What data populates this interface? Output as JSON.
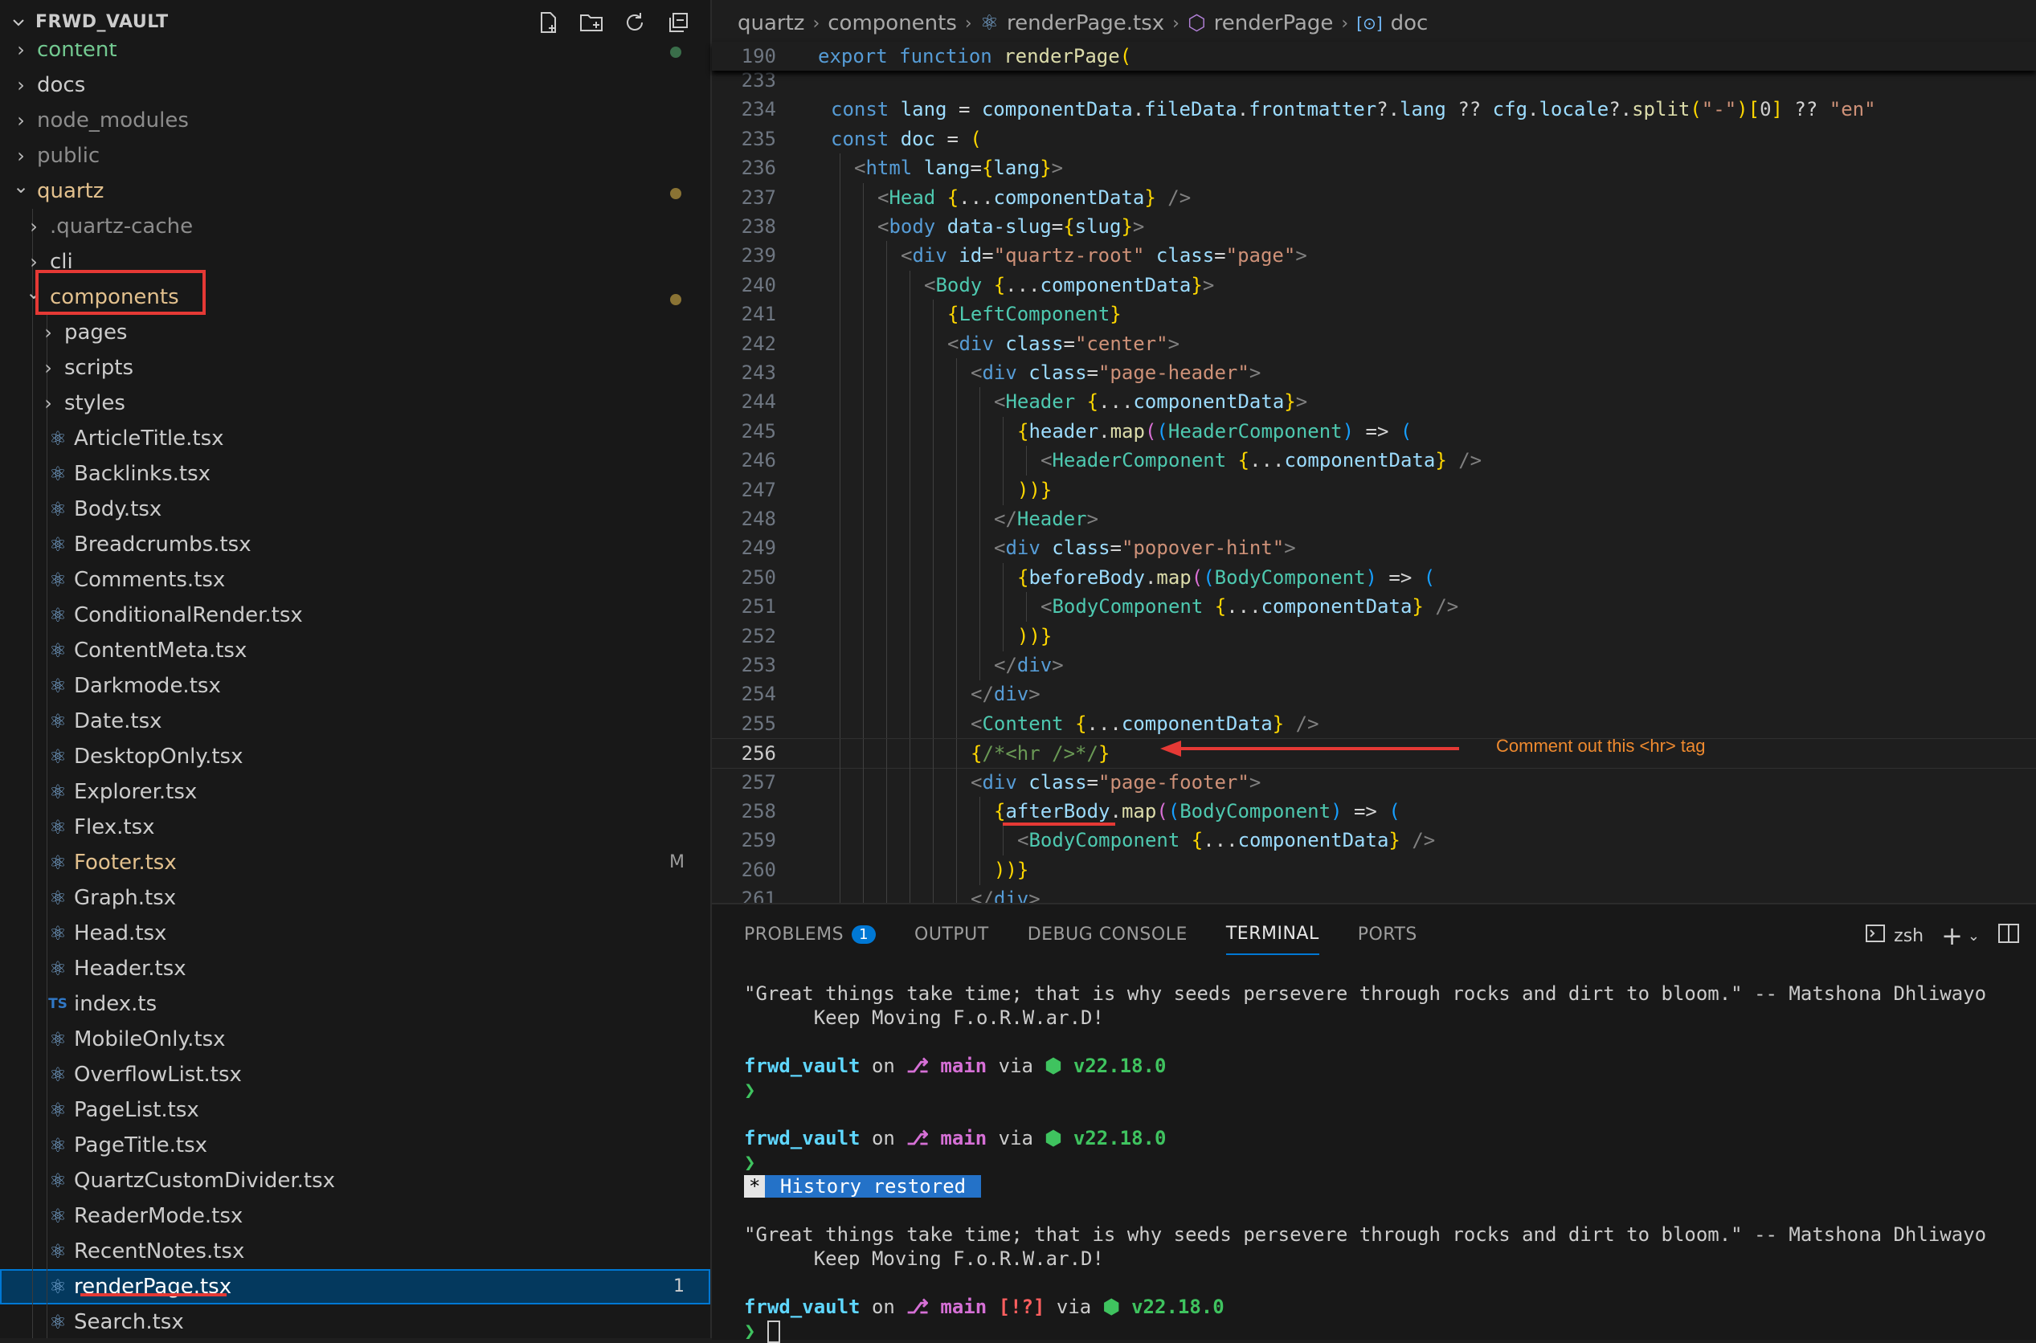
{
  "explorer": {
    "title": "FRWD_VAULT",
    "items": [
      {
        "label": "content",
        "type": "folder",
        "open": false,
        "depth": 0,
        "color": "#73c991",
        "dot": "#3a6e4a"
      },
      {
        "label": "docs",
        "type": "folder",
        "open": false,
        "depth": 0
      },
      {
        "label": "node_modules",
        "type": "folder",
        "open": false,
        "depth": 0,
        "color": "#8c8c8c"
      },
      {
        "label": "public",
        "type": "folder",
        "open": false,
        "depth": 0,
        "color": "#8c8c8c"
      },
      {
        "label": "quartz",
        "type": "folder",
        "open": true,
        "depth": 0,
        "color": "#e2c08d",
        "dot": "#8a7334"
      },
      {
        "label": ".quartz-cache",
        "type": "folder",
        "open": false,
        "depth": 1,
        "color": "#8c8c8c"
      },
      {
        "label": "cli",
        "type": "folder",
        "open": false,
        "depth": 1
      },
      {
        "label": "components",
        "type": "folder",
        "open": true,
        "depth": 1,
        "color": "#e2c08d",
        "dot": "#8a7334"
      },
      {
        "label": "pages",
        "type": "folder",
        "open": false,
        "depth": 2
      },
      {
        "label": "scripts",
        "type": "folder",
        "open": false,
        "depth": 2
      },
      {
        "label": "styles",
        "type": "folder",
        "open": false,
        "depth": 2
      },
      {
        "label": "ArticleTitle.tsx",
        "type": "react",
        "depth": 2
      },
      {
        "label": "Backlinks.tsx",
        "type": "react",
        "depth": 2
      },
      {
        "label": "Body.tsx",
        "type": "react",
        "depth": 2
      },
      {
        "label": "Breadcrumbs.tsx",
        "type": "react",
        "depth": 2
      },
      {
        "label": "Comments.tsx",
        "type": "react",
        "depth": 2
      },
      {
        "label": "ConditionalRender.tsx",
        "type": "react",
        "depth": 2
      },
      {
        "label": "ContentMeta.tsx",
        "type": "react",
        "depth": 2
      },
      {
        "label": "Darkmode.tsx",
        "type": "react",
        "depth": 2
      },
      {
        "label": "Date.tsx",
        "type": "react",
        "depth": 2
      },
      {
        "label": "DesktopOnly.tsx",
        "type": "react",
        "depth": 2
      },
      {
        "label": "Explorer.tsx",
        "type": "react",
        "depth": 2
      },
      {
        "label": "Flex.tsx",
        "type": "react",
        "depth": 2
      },
      {
        "label": "Footer.tsx",
        "type": "react",
        "depth": 2,
        "color": "#e2c08d",
        "mark": "M"
      },
      {
        "label": "Graph.tsx",
        "type": "react",
        "depth": 2
      },
      {
        "label": "Head.tsx",
        "type": "react",
        "depth": 2
      },
      {
        "label": "Header.tsx",
        "type": "react",
        "depth": 2
      },
      {
        "label": "index.ts",
        "type": "ts",
        "depth": 2
      },
      {
        "label": "MobileOnly.tsx",
        "type": "react",
        "depth": 2
      },
      {
        "label": "OverflowList.tsx",
        "type": "react",
        "depth": 2
      },
      {
        "label": "PageList.tsx",
        "type": "react",
        "depth": 2
      },
      {
        "label": "PageTitle.tsx",
        "type": "react",
        "depth": 2
      },
      {
        "label": "QuartzCustomDivider.tsx",
        "type": "react",
        "depth": 2
      },
      {
        "label": "ReaderMode.tsx",
        "type": "react",
        "depth": 2
      },
      {
        "label": "RecentNotes.tsx",
        "type": "react",
        "depth": 2
      },
      {
        "label": "renderPage.tsx",
        "type": "react",
        "depth": 2,
        "selected": true,
        "mark": "1",
        "color": "#ffffff"
      },
      {
        "label": "Search.tsx",
        "type": "react",
        "depth": 2
      }
    ],
    "ts_icon_text": "TS"
  },
  "breadcrumb": [
    "quartz",
    "components",
    "renderPage.tsx",
    "renderPage",
    "doc"
  ],
  "editor": {
    "sticky_line": {
      "num": "190",
      "code": "export function renderPage("
    },
    "lines": [
      {
        "num": "233",
        "indent": 0,
        "code": ""
      },
      {
        "num": "234",
        "indent": 1,
        "code": "const lang = componentData.fileData.frontmatter?.lang ?? cfg.locale?.split(\"-\")[0] ?? \"en\""
      },
      {
        "num": "235",
        "indent": 1,
        "code": "const doc = ("
      },
      {
        "num": "236",
        "indent": 2,
        "code": "<html lang={lang}>"
      },
      {
        "num": "237",
        "indent": 3,
        "code": "<Head {...componentData} />"
      },
      {
        "num": "238",
        "indent": 3,
        "code": "<body data-slug={slug}>"
      },
      {
        "num": "239",
        "indent": 4,
        "code": "<div id=\"quartz-root\" class=\"page\">"
      },
      {
        "num": "240",
        "indent": 5,
        "code": "<Body {...componentData}>"
      },
      {
        "num": "241",
        "indent": 6,
        "code": "{LeftComponent}"
      },
      {
        "num": "242",
        "indent": 6,
        "code": "<div class=\"center\">"
      },
      {
        "num": "243",
        "indent": 7,
        "code": "<div class=\"page-header\">"
      },
      {
        "num": "244",
        "indent": 8,
        "code": "<Header {...componentData}>"
      },
      {
        "num": "245",
        "indent": 9,
        "code": "{header.map((HeaderComponent) => ("
      },
      {
        "num": "246",
        "indent": 10,
        "code": "<HeaderComponent {...componentData} />"
      },
      {
        "num": "247",
        "indent": 9,
        "code": "))}"
      },
      {
        "num": "248",
        "indent": 8,
        "code": "</Header>"
      },
      {
        "num": "249",
        "indent": 8,
        "code": "<div class=\"popover-hint\">"
      },
      {
        "num": "250",
        "indent": 9,
        "code": "{beforeBody.map((BodyComponent) => ("
      },
      {
        "num": "251",
        "indent": 10,
        "code": "<BodyComponent {...componentData} />"
      },
      {
        "num": "252",
        "indent": 9,
        "code": "))}"
      },
      {
        "num": "253",
        "indent": 8,
        "code": "</div>"
      },
      {
        "num": "254",
        "indent": 7,
        "code": "</div>"
      },
      {
        "num": "255",
        "indent": 7,
        "code": "<Content {...componentData} />"
      },
      {
        "num": "256",
        "indent": 7,
        "code": "{/*<hr />*/}",
        "current": true
      },
      {
        "num": "257",
        "indent": 7,
        "code": "<div class=\"page-footer\">"
      },
      {
        "num": "258",
        "indent": 8,
        "code": "{afterBody.map((BodyComponent) => ("
      },
      {
        "num": "259",
        "indent": 9,
        "code": "<BodyComponent {...componentData} />"
      },
      {
        "num": "260",
        "indent": 8,
        "code": "))}"
      },
      {
        "num": "261",
        "indent": 7,
        "code": "</div>"
      }
    ],
    "annotation": "Comment out this <hr> tag",
    "accent": "#e53935"
  },
  "panel": {
    "tabs": [
      {
        "label": "PROBLEMS",
        "badge": "1"
      },
      {
        "label": "OUTPUT"
      },
      {
        "label": "DEBUG CONSOLE"
      },
      {
        "label": "TERMINAL",
        "active": true
      },
      {
        "label": "PORTS"
      }
    ],
    "shell": "zsh",
    "terminal": {
      "quote_line1": "\"Great things take time; that is why seeds persevere through rocks and dirt to bloom.\" -- Matshona Dhliwayo",
      "quote_line2": "      Keep Moving F.o.R.W.ar.D!",
      "prompt_dir": "frwd_vault",
      "prompt_on": " on ",
      "branch_icon": "⎇",
      "branch": "main",
      "via": " via ",
      "node_icon": "⬢",
      "node_version": "v22.18.0",
      "caret": "❯",
      "history_star": "*",
      "history_text": " History restored ",
      "status_flags": "[!?]"
    }
  }
}
